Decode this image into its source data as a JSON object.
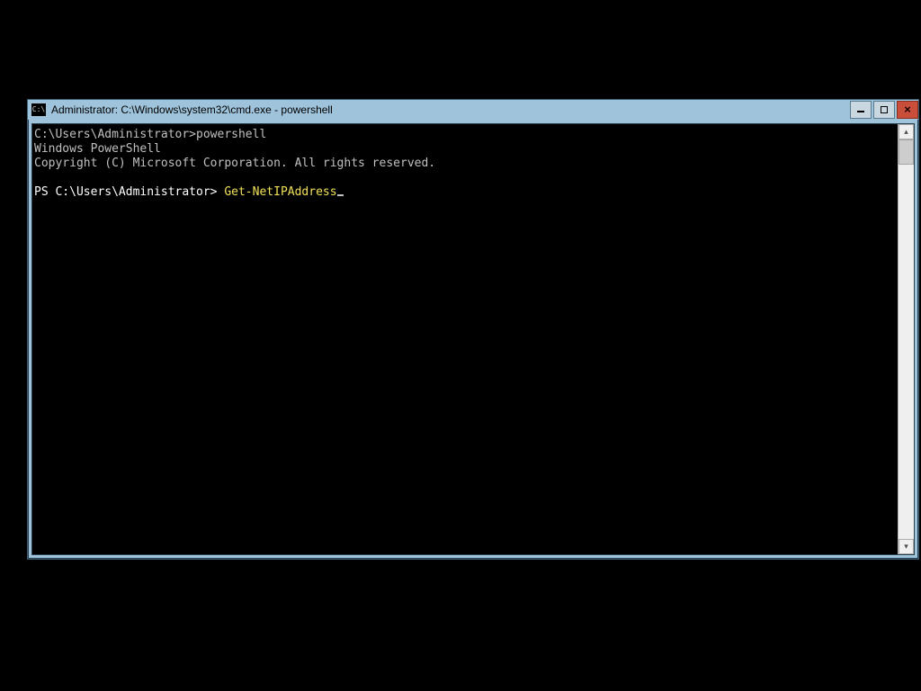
{
  "window": {
    "title": "Administrator: C:\\Windows\\system32\\cmd.exe - powershell"
  },
  "console": {
    "line1_prompt": "C:\\Users\\Administrator>",
    "line1_cmd": "powershell",
    "line2": "Windows PowerShell",
    "line3": "Copyright (C) Microsoft Corporation. All rights reserved.",
    "ps_prompt": "PS C:\\Users\\Administrator> ",
    "ps_command": "Get-NetIPAddress"
  }
}
